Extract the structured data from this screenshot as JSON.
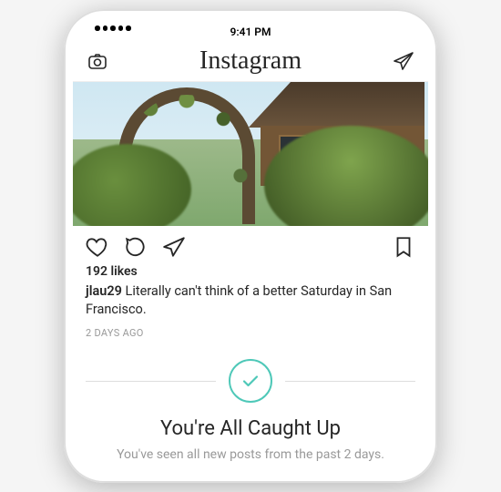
{
  "status": {
    "time": "9:41 PM"
  },
  "header": {
    "logo": "Instagram"
  },
  "post": {
    "likes": "192 likes",
    "username": "jlau29",
    "caption_text": "Literally can't think of a better Saturday in San Francisco.",
    "time_ago": "2 DAYS AGO"
  },
  "caught_up": {
    "title": "You're All Caught Up",
    "subtitle": "You've seen all new posts from the past 2 days."
  }
}
